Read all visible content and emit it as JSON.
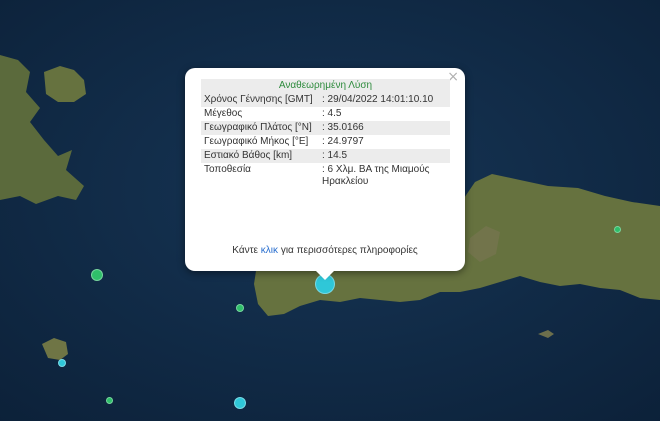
{
  "popup": {
    "title": "Αναθεωρημένη Λύση",
    "rows": [
      {
        "label": "Χρόνος Γέννησης [GMT]",
        "value": ": 29/04/2022 14:01:10.10"
      },
      {
        "label": "Μέγεθος",
        "value": ": 4.5"
      },
      {
        "label": "Γεωγραφικό Πλάτος [°N]",
        "value": ": 35.0166"
      },
      {
        "label": "Γεωγραφικό Μήκος [°E]",
        "value": ": 24.9797"
      },
      {
        "label": "Εστιακό Βάθος [km]",
        "value": ": 14.5"
      },
      {
        "label": "Τοποθεσία",
        "value": ": 6 Χλμ. ΒΑ της Μιαμούς Ηρακλείου"
      }
    ],
    "footer_prefix": "Κάντε",
    "footer_link": "κλικ",
    "footer_suffix": "για περισσότερες πληροφορίες",
    "close_symbol": "×"
  },
  "colors": {
    "sea": "#102844",
    "land": "#5e6b3f",
    "popup_title": "#2e8b3d",
    "link": "#2a6fcf",
    "marker_green": "#2fbf6a",
    "marker_cyan": "#2fc7d8"
  }
}
